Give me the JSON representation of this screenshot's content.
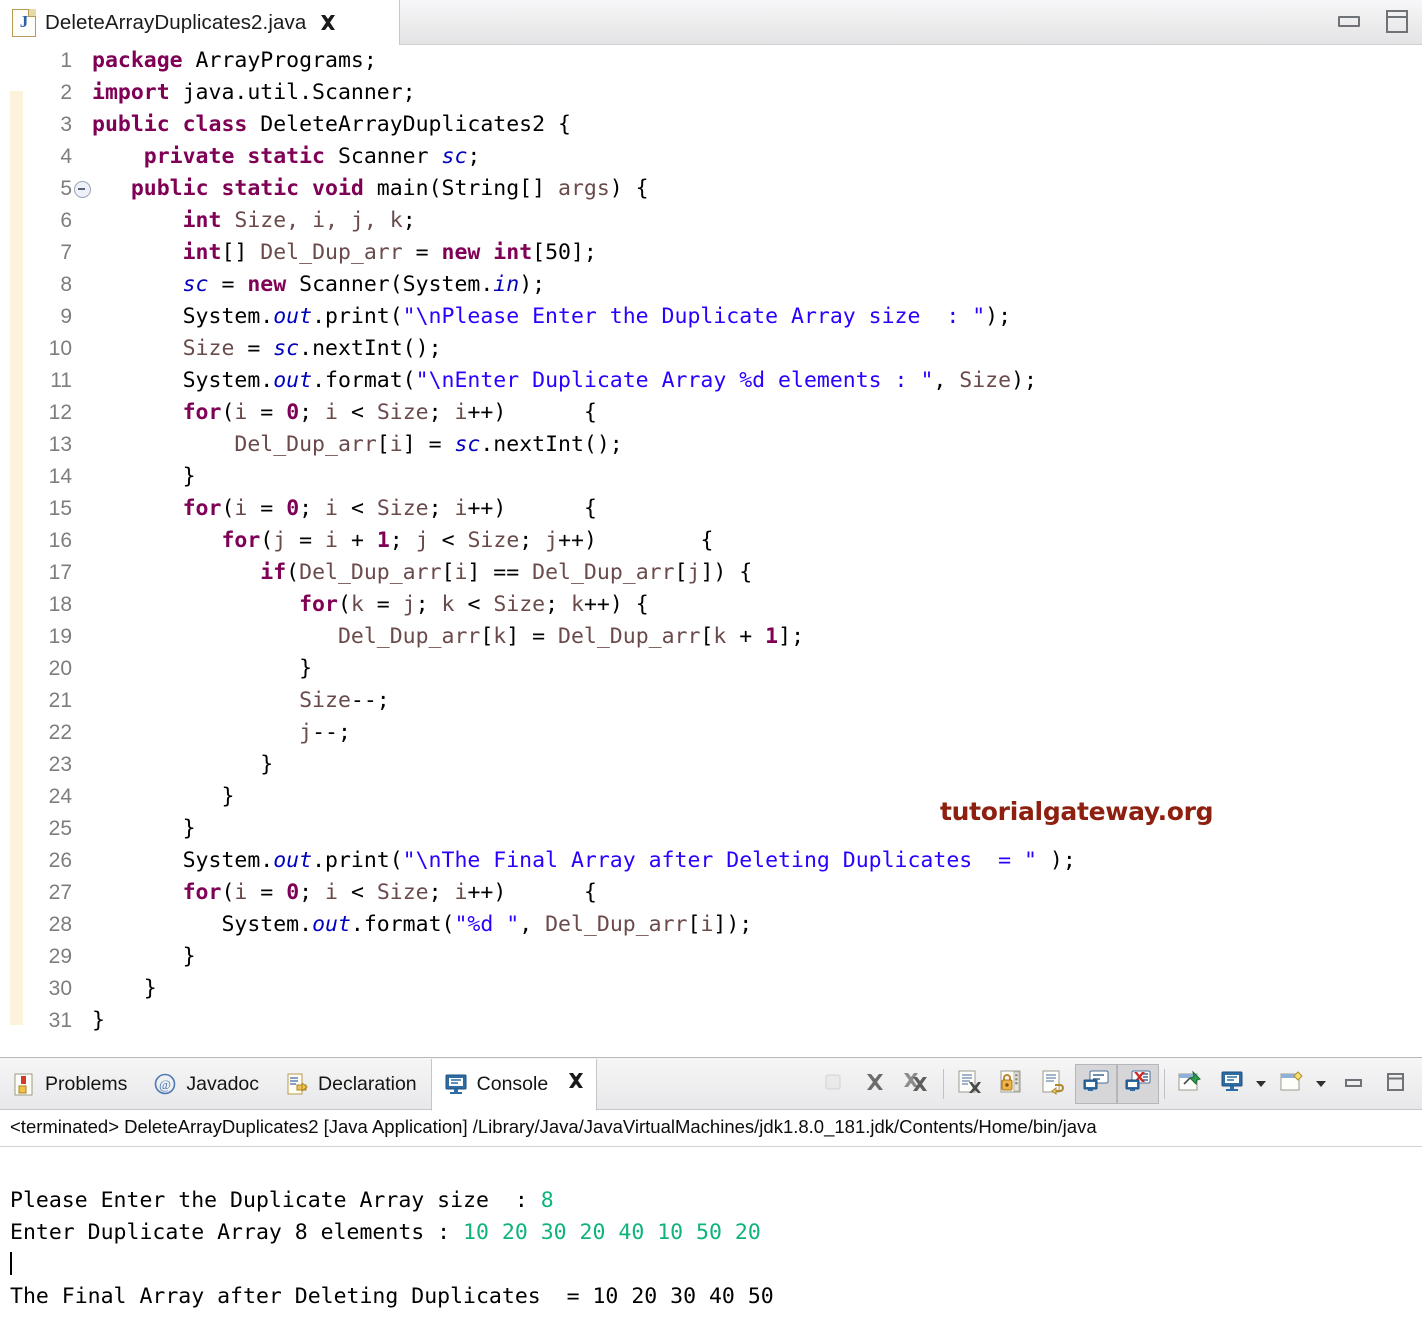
{
  "window": {
    "minimize_icon": "minimize-icon",
    "maximize_icon": "maximize-icon"
  },
  "editor": {
    "tab": {
      "icon": "java-file-icon",
      "icon_letter": "J",
      "label": "DeleteArrayDuplicates2.java",
      "close_icon": "close-icon"
    },
    "fold_marker_line": 5,
    "lines": [
      {
        "n": "1",
        "tokens": [
          {
            "t": "package",
            "c": "k"
          },
          {
            "t": " ArrayPrograms;",
            "c": "pl"
          }
        ]
      },
      {
        "n": "2",
        "tokens": [
          {
            "t": "import",
            "c": "k"
          },
          {
            "t": " java.util.Scanner;",
            "c": "pl"
          }
        ]
      },
      {
        "n": "3",
        "tokens": [
          {
            "t": "public class",
            "c": "k"
          },
          {
            "t": " DeleteArrayDuplicates2 {",
            "c": "pl"
          }
        ]
      },
      {
        "n": "4",
        "tokens": [
          {
            "t": "    ",
            "c": "pl"
          },
          {
            "t": "private static",
            "c": "k"
          },
          {
            "t": " Scanner ",
            "c": "pl"
          },
          {
            "t": "sc",
            "c": "fld"
          },
          {
            "t": ";",
            "c": "pl"
          }
        ]
      },
      {
        "n": "5",
        "tokens": [
          {
            "t": "   ",
            "c": "pl"
          },
          {
            "t": "public static void",
            "c": "k"
          },
          {
            "t": " main(String[] ",
            "c": "pl"
          },
          {
            "t": "args",
            "c": "lv"
          },
          {
            "t": ") {",
            "c": "pl"
          }
        ]
      },
      {
        "n": "6",
        "tokens": [
          {
            "t": "       ",
            "c": "pl"
          },
          {
            "t": "int",
            "c": "k"
          },
          {
            "t": " ",
            "c": "pl"
          },
          {
            "t": "Size, i, j, k",
            "c": "lv"
          },
          {
            "t": ";",
            "c": "pl"
          }
        ]
      },
      {
        "n": "7",
        "tokens": [
          {
            "t": "       ",
            "c": "pl"
          },
          {
            "t": "int",
            "c": "k"
          },
          {
            "t": "[] ",
            "c": "pl"
          },
          {
            "t": "Del_Dup_arr",
            "c": "lv"
          },
          {
            "t": " = ",
            "c": "pl"
          },
          {
            "t": "new int",
            "c": "k"
          },
          {
            "t": "[50];",
            "c": "pl"
          }
        ]
      },
      {
        "n": "8",
        "tokens": [
          {
            "t": "       ",
            "c": "pl"
          },
          {
            "t": "sc",
            "c": "fld"
          },
          {
            "t": " = ",
            "c": "pl"
          },
          {
            "t": "new",
            "c": "k"
          },
          {
            "t": " Scanner(System.",
            "c": "pl"
          },
          {
            "t": "in",
            "c": "fld"
          },
          {
            "t": ");",
            "c": "pl"
          }
        ]
      },
      {
        "n": "9",
        "tokens": [
          {
            "t": "       System.",
            "c": "pl"
          },
          {
            "t": "out",
            "c": "fld"
          },
          {
            "t": ".print(",
            "c": "pl"
          },
          {
            "t": "\"\\nPlease Enter the Duplicate Array size  : \"",
            "c": "str"
          },
          {
            "t": ");",
            "c": "pl"
          }
        ]
      },
      {
        "n": "10",
        "tokens": [
          {
            "t": "       ",
            "c": "pl"
          },
          {
            "t": "Size",
            "c": "lv"
          },
          {
            "t": " = ",
            "c": "pl"
          },
          {
            "t": "sc",
            "c": "fld"
          },
          {
            "t": ".nextInt();",
            "c": "pl"
          }
        ]
      },
      {
        "n": "11",
        "tokens": [
          {
            "t": "       System.",
            "c": "pl"
          },
          {
            "t": "out",
            "c": "fld"
          },
          {
            "t": ".format(",
            "c": "pl"
          },
          {
            "t": "\"\\nEnter Duplicate Array %d elements : \"",
            "c": "str"
          },
          {
            "t": ", ",
            "c": "pl"
          },
          {
            "t": "Size",
            "c": "lv"
          },
          {
            "t": ");",
            "c": "pl"
          }
        ]
      },
      {
        "n": "12",
        "tokens": [
          {
            "t": "       ",
            "c": "pl"
          },
          {
            "t": "for",
            "c": "k"
          },
          {
            "t": "(",
            "c": "pl"
          },
          {
            "t": "i",
            "c": "lv"
          },
          {
            "t": " = ",
            "c": "pl"
          },
          {
            "t": "0",
            "c": "k"
          },
          {
            "t": "; ",
            "c": "pl"
          },
          {
            "t": "i",
            "c": "lv"
          },
          {
            "t": " < ",
            "c": "pl"
          },
          {
            "t": "Size",
            "c": "lv"
          },
          {
            "t": "; ",
            "c": "pl"
          },
          {
            "t": "i",
            "c": "lv"
          },
          {
            "t": "++)      {",
            "c": "pl"
          }
        ]
      },
      {
        "n": "13",
        "tokens": [
          {
            "t": "           ",
            "c": "pl"
          },
          {
            "t": "Del_Dup_arr",
            "c": "lv"
          },
          {
            "t": "[",
            "c": "pl"
          },
          {
            "t": "i",
            "c": "lv"
          },
          {
            "t": "] = ",
            "c": "pl"
          },
          {
            "t": "sc",
            "c": "fld"
          },
          {
            "t": ".nextInt();",
            "c": "pl"
          }
        ]
      },
      {
        "n": "14",
        "tokens": [
          {
            "t": "       }",
            "c": "pl"
          }
        ]
      },
      {
        "n": "15",
        "tokens": [
          {
            "t": "       ",
            "c": "pl"
          },
          {
            "t": "for",
            "c": "k"
          },
          {
            "t": "(",
            "c": "pl"
          },
          {
            "t": "i",
            "c": "lv"
          },
          {
            "t": " = ",
            "c": "pl"
          },
          {
            "t": "0",
            "c": "k"
          },
          {
            "t": "; ",
            "c": "pl"
          },
          {
            "t": "i",
            "c": "lv"
          },
          {
            "t": " < ",
            "c": "pl"
          },
          {
            "t": "Size",
            "c": "lv"
          },
          {
            "t": "; ",
            "c": "pl"
          },
          {
            "t": "i",
            "c": "lv"
          },
          {
            "t": "++)      {",
            "c": "pl"
          }
        ]
      },
      {
        "n": "16",
        "tokens": [
          {
            "t": "          ",
            "c": "pl"
          },
          {
            "t": "for",
            "c": "k"
          },
          {
            "t": "(",
            "c": "pl"
          },
          {
            "t": "j",
            "c": "lv"
          },
          {
            "t": " = ",
            "c": "pl"
          },
          {
            "t": "i",
            "c": "lv"
          },
          {
            "t": " + ",
            "c": "pl"
          },
          {
            "t": "1",
            "c": "k"
          },
          {
            "t": "; ",
            "c": "pl"
          },
          {
            "t": "j",
            "c": "lv"
          },
          {
            "t": " < ",
            "c": "pl"
          },
          {
            "t": "Size",
            "c": "lv"
          },
          {
            "t": "; ",
            "c": "pl"
          },
          {
            "t": "j",
            "c": "lv"
          },
          {
            "t": "++)        {",
            "c": "pl"
          }
        ]
      },
      {
        "n": "17",
        "tokens": [
          {
            "t": "             ",
            "c": "pl"
          },
          {
            "t": "if",
            "c": "k"
          },
          {
            "t": "(",
            "c": "pl"
          },
          {
            "t": "Del_Dup_arr",
            "c": "lv"
          },
          {
            "t": "[",
            "c": "pl"
          },
          {
            "t": "i",
            "c": "lv"
          },
          {
            "t": "] == ",
            "c": "pl"
          },
          {
            "t": "Del_Dup_arr",
            "c": "lv"
          },
          {
            "t": "[",
            "c": "pl"
          },
          {
            "t": "j",
            "c": "lv"
          },
          {
            "t": "]) {",
            "c": "pl"
          }
        ]
      },
      {
        "n": "18",
        "tokens": [
          {
            "t": "                ",
            "c": "pl"
          },
          {
            "t": "for",
            "c": "k"
          },
          {
            "t": "(",
            "c": "pl"
          },
          {
            "t": "k",
            "c": "lv"
          },
          {
            "t": " = ",
            "c": "pl"
          },
          {
            "t": "j",
            "c": "lv"
          },
          {
            "t": "; ",
            "c": "pl"
          },
          {
            "t": "k",
            "c": "lv"
          },
          {
            "t": " < ",
            "c": "pl"
          },
          {
            "t": "Size",
            "c": "lv"
          },
          {
            "t": "; ",
            "c": "pl"
          },
          {
            "t": "k",
            "c": "lv"
          },
          {
            "t": "++) {",
            "c": "pl"
          }
        ]
      },
      {
        "n": "19",
        "tokens": [
          {
            "t": "                   ",
            "c": "pl"
          },
          {
            "t": "Del_Dup_arr",
            "c": "lv"
          },
          {
            "t": "[",
            "c": "pl"
          },
          {
            "t": "k",
            "c": "lv"
          },
          {
            "t": "] = ",
            "c": "pl"
          },
          {
            "t": "Del_Dup_arr",
            "c": "lv"
          },
          {
            "t": "[",
            "c": "pl"
          },
          {
            "t": "k",
            "c": "lv"
          },
          {
            "t": " + ",
            "c": "pl"
          },
          {
            "t": "1",
            "c": "k"
          },
          {
            "t": "];",
            "c": "pl"
          }
        ]
      },
      {
        "n": "20",
        "tokens": [
          {
            "t": "                }",
            "c": "pl"
          }
        ]
      },
      {
        "n": "21",
        "tokens": [
          {
            "t": "                ",
            "c": "pl"
          },
          {
            "t": "Size",
            "c": "lv"
          },
          {
            "t": "--;",
            "c": "pl"
          }
        ]
      },
      {
        "n": "22",
        "tokens": [
          {
            "t": "                ",
            "c": "pl"
          },
          {
            "t": "j",
            "c": "lv"
          },
          {
            "t": "--;",
            "c": "pl"
          }
        ]
      },
      {
        "n": "23",
        "tokens": [
          {
            "t": "             }",
            "c": "pl"
          }
        ]
      },
      {
        "n": "24",
        "tokens": [
          {
            "t": "          }",
            "c": "pl"
          }
        ]
      },
      {
        "n": "25",
        "tokens": [
          {
            "t": "       }",
            "c": "pl"
          }
        ]
      },
      {
        "n": "26",
        "tokens": [
          {
            "t": "       System.",
            "c": "pl"
          },
          {
            "t": "out",
            "c": "fld"
          },
          {
            "t": ".print(",
            "c": "pl"
          },
          {
            "t": "\"\\nThe Final Array after Deleting Duplicates  = \"",
            "c": "str"
          },
          {
            "t": " );",
            "c": "pl"
          }
        ]
      },
      {
        "n": "27",
        "tokens": [
          {
            "t": "       ",
            "c": "pl"
          },
          {
            "t": "for",
            "c": "k"
          },
          {
            "t": "(",
            "c": "pl"
          },
          {
            "t": "i",
            "c": "lv"
          },
          {
            "t": " = ",
            "c": "pl"
          },
          {
            "t": "0",
            "c": "k"
          },
          {
            "t": "; ",
            "c": "pl"
          },
          {
            "t": "i",
            "c": "lv"
          },
          {
            "t": " < ",
            "c": "pl"
          },
          {
            "t": "Size",
            "c": "lv"
          },
          {
            "t": "; ",
            "c": "pl"
          },
          {
            "t": "i",
            "c": "lv"
          },
          {
            "t": "++)      {",
            "c": "pl"
          }
        ]
      },
      {
        "n": "28",
        "tokens": [
          {
            "t": "          System.",
            "c": "pl"
          },
          {
            "t": "out",
            "c": "fld"
          },
          {
            "t": ".format(",
            "c": "pl"
          },
          {
            "t": "\"%d \"",
            "c": "str"
          },
          {
            "t": ", ",
            "c": "pl"
          },
          {
            "t": "Del_Dup_arr",
            "c": "lv"
          },
          {
            "t": "[",
            "c": "pl"
          },
          {
            "t": "i",
            "c": "lv"
          },
          {
            "t": "]);",
            "c": "pl"
          }
        ]
      },
      {
        "n": "29",
        "tokens": [
          {
            "t": "       }",
            "c": "pl"
          }
        ]
      },
      {
        "n": "30",
        "tokens": [
          {
            "t": "    }",
            "c": "pl"
          }
        ]
      },
      {
        "n": "31",
        "tokens": [
          {
            "t": "}",
            "c": "pl"
          }
        ]
      }
    ],
    "watermark": "tutorialgateway.org"
  },
  "panel": {
    "tabs": [
      {
        "label": "Problems",
        "icon": "problems-icon",
        "selected": false
      },
      {
        "label": "Javadoc",
        "icon": "javadoc-icon",
        "selected": false
      },
      {
        "label": "Declaration",
        "icon": "declaration-icon",
        "selected": false
      },
      {
        "label": "Console",
        "icon": "console-icon",
        "selected": true,
        "close_icon": "close-icon"
      }
    ],
    "toolbar": [
      {
        "name": "terminate-button",
        "icon": "stop-square-icon",
        "pressed": false,
        "disabled": true
      },
      {
        "name": "remove-launch-button",
        "icon": "remove-x-icon",
        "pressed": false
      },
      {
        "name": "remove-all-launches-button",
        "icon": "remove-all-xx-icon",
        "pressed": false
      },
      {
        "sep": true
      },
      {
        "name": "clear-console-button",
        "icon": "clear-console-icon",
        "pressed": false
      },
      {
        "name": "scroll-lock-button",
        "icon": "scroll-lock-icon",
        "pressed": false
      },
      {
        "name": "word-wrap-button",
        "icon": "word-wrap-icon",
        "pressed": false
      },
      {
        "name": "show-console-on-output-button",
        "icon": "console-stdout-icon",
        "pressed": true
      },
      {
        "name": "show-console-on-error-button",
        "icon": "console-stderr-icon",
        "pressed": true
      },
      {
        "sep": true
      },
      {
        "name": "pin-console-button",
        "icon": "pin-icon",
        "pressed": false
      },
      {
        "name": "display-selected-console-button",
        "icon": "display-console-icon",
        "pressed": false,
        "dropdown": true
      },
      {
        "name": "open-console-button",
        "icon": "new-console-icon",
        "pressed": false,
        "dropdown": true
      },
      {
        "name": "minimize-panel-button",
        "icon": "minimize-icon",
        "pressed": false
      },
      {
        "name": "maximize-panel-button",
        "icon": "maximize-icon",
        "pressed": false
      }
    ],
    "launch_description": "<terminated> DeleteArrayDuplicates2 [Java Application] /Library/Java/JavaVirtualMachines/jdk1.8.0_181.jdk/Contents/Home/bin/java",
    "output": {
      "prompt_size_label": "Please Enter the Duplicate Array size  : ",
      "size_value": "8",
      "prompt_elements_label": "Enter Duplicate Array 8 elements : ",
      "elements_value": "10 20 30 20 40 10 50 20",
      "result_label": "The Final Array after Deleting Duplicates  = 10 20 30 40 50"
    }
  },
  "colors": {
    "keyword": "#7f0055",
    "string": "#2a00ff",
    "static_field": "#0000c0",
    "local_var": "#6a4a4a",
    "console_input": "#0fb37c",
    "watermark": "#8e2010",
    "fold_strip": "#fdf3dd"
  }
}
